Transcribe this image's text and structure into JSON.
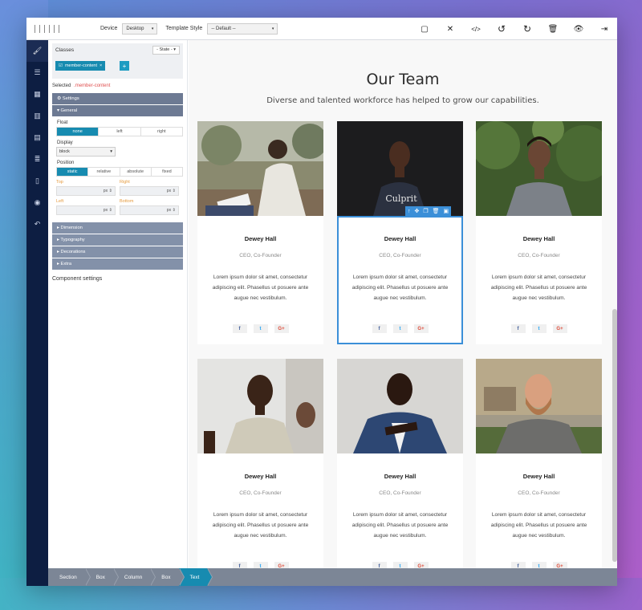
{
  "toolbar": {
    "device_label": "Device",
    "device_value": "Desktop",
    "template_label": "Template Style",
    "template_value": "-- Default --",
    "icons": [
      "square-icon",
      "fullscreen-icon",
      "code-icon",
      "undo-icon",
      "redo-icon",
      "trash-icon",
      "eye-icon",
      "export-icon"
    ]
  },
  "rail": {
    "icons": [
      "brush-icon",
      "menu-icon",
      "grid-icon",
      "book-icon",
      "layout-icon",
      "list-icon",
      "document-icon",
      "user-icon",
      "history-icon"
    ]
  },
  "panel": {
    "classes_title": "Classes",
    "state_label": "- State -",
    "tag_label": "member-content",
    "tag_check": "☑",
    "tag_close": "×",
    "add_label": "+",
    "selected_label": "Selected",
    "selected_value": ".member-content",
    "settings_label": "⚙ Settings",
    "general_label": "▾ General",
    "float_label": "Float",
    "float_options": [
      "none",
      "left",
      "right"
    ],
    "display_label": "Display",
    "display_value": "block",
    "position_label": "Position",
    "position_options": [
      "static",
      "relative",
      "absolute",
      "fixed"
    ],
    "top_label": "Top",
    "right_label": "Right",
    "left_label": "Left",
    "bottom_label": "Bottom",
    "unit": "px ⇕",
    "dimension_label": "▸ Dimension",
    "typography_label": "▸ Typography",
    "decorations_label": "▸ Decorations",
    "extra_label": "▸ Extra",
    "component_settings": "Component settings"
  },
  "canvas": {
    "title": "Our Team",
    "subtitle": "Diverse and talented workforce has helped to grow our capabilities.",
    "members": [
      {
        "name": "Dewey Hall",
        "role": "CEO, Co-Founder",
        "desc": "Lorem ipsum dolor sit amet, consectetur adipiscing elit. Phasellus ut posuere ante augue nec vestibulum.",
        "fb": "f",
        "tw": "t",
        "gp": "G+"
      },
      {
        "name": "Dewey Hall",
        "role": "CEO, Co-Founder",
        "desc": "Lorem ipsum dolor sit amet, consectetur adipiscing elit. Phasellus ut posuere ante augue nec vestibulum.",
        "fb": "f",
        "tw": "t",
        "gp": "G+"
      },
      {
        "name": "Dewey Hall",
        "role": "CEO, Co-Founder",
        "desc": "Lorem ipsum dolor sit amet, consectetur adipiscing elit. Phasellus ut posuere ante augue nec vestibulum.",
        "fb": "f",
        "tw": "t",
        "gp": "G+"
      },
      {
        "name": "Dewey Hall",
        "role": "CEO, Co-Founder",
        "desc": "Lorem ipsum dolor sit amet, consectetur adipiscing elit. Phasellus ut posuere ante augue nec vestibulum.",
        "fb": "f",
        "tw": "t",
        "gp": "G+"
      },
      {
        "name": "Dewey Hall",
        "role": "CEO, Co-Founder",
        "desc": "Lorem ipsum dolor sit amet, consectetur adipiscing elit. Phasellus ut posuere ante augue nec vestibulum.",
        "fb": "f",
        "tw": "t",
        "gp": "G+"
      },
      {
        "name": "Dewey Hall",
        "role": "CEO, Co-Founder",
        "desc": "Lorem ipsum dolor sit amet, consectetur adipiscing elit. Phasellus ut posuere ante augue nec vestibulum.",
        "fb": "f",
        "tw": "t",
        "gp": "G+"
      }
    ]
  },
  "breadcrumb": [
    "Section",
    "Box",
    "Column",
    "Box",
    "Text"
  ],
  "colors": {
    "accent": "#178bb0",
    "rail": "#0d1e42",
    "selection": "#3b8fd8"
  }
}
